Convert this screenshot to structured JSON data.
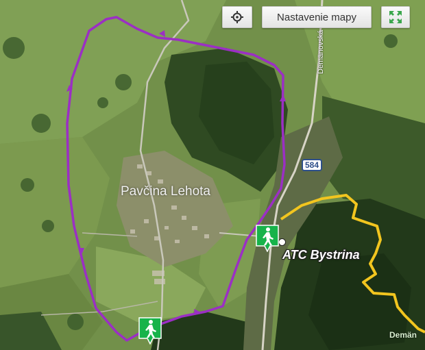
{
  "controls": {
    "locate_icon": "crosshair-icon",
    "settings_label": "Nastavenie mapy",
    "fullscreen_icon": "expand-arrows-icon"
  },
  "labels": {
    "village": "Pavčina Lehota",
    "atc": "ATC Bystrina",
    "road_number": "584",
    "street": "Demänovská",
    "town_edge": "Demän"
  },
  "markers": [
    {
      "type": "hiking",
      "icon": "hiker-icon",
      "color": "#17b34a"
    },
    {
      "type": "hiking",
      "icon": "hiker-icon",
      "color": "#17b34a"
    }
  ],
  "colors": {
    "route_purple": "#9b2fc4",
    "trail_yellow": "#f2c51f",
    "marker_green": "#17b34a",
    "road_shield": "#2d4f8a"
  }
}
